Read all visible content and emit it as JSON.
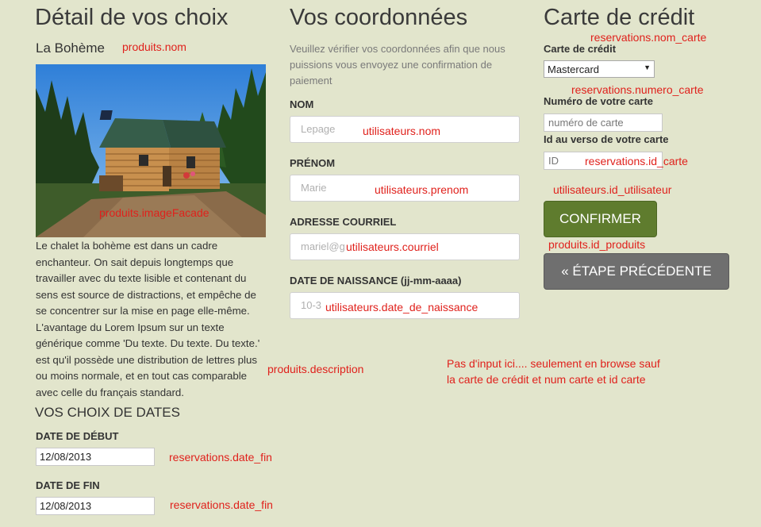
{
  "left": {
    "title": "Détail de vos choix",
    "product_name": "La Bohème",
    "description": "Le chalet la bohème est dans un cadre enchanteur. On sait depuis longtemps que travailler avec du texte lisible et contenant du sens est source de distractions, et empêche de se concentrer sur la mise en page elle-même. L'avantage du Lorem Ipsum sur un texte générique comme 'Du texte. Du texte. Du texte.' est qu'il possède une distribution de lettres plus ou moins normale, et en tout cas comparable avec celle du français standard.",
    "dates_heading": "VOS CHOIX DE DATES",
    "start_label": "DATE DE DÉBUT",
    "start_value": "12/08/2013",
    "end_label": "DATE DE FIN",
    "end_value": "12/08/2013"
  },
  "middle": {
    "title": "Vos coordonnées",
    "intro": "Veuillez vérifier vos coordonnées afin que nous puissions vous envoyez une confirmation de paiement",
    "nom_label": "NOM",
    "nom_value": "Lepage",
    "prenom_label": "PRÉNOM",
    "prenom_value": "Marie",
    "courriel_label": "ADRESSE COURRIEL",
    "courriel_value": "mariel@g",
    "naissance_label": "DATE DE NAISSANCE (jj-mm-aaaa)",
    "naissance_value": "10-3"
  },
  "right": {
    "title": "Carte de crédit",
    "card_type_label": "Carte de crédit",
    "card_type_value": "Mastercard",
    "card_number_label": "Numéro de votre carte",
    "card_number_placeholder": "numéro de carte",
    "card_id_label": "Id au verso de votre carte",
    "card_id_placeholder": "ID",
    "confirm_button": "CONFIRMER",
    "previous_button": "« ÉTAPE PRÉCÉDENTE"
  },
  "annotations": {
    "produits_nom": "produits.nom",
    "produits_image": "produits.imageFacade",
    "produits_description": "produits.description",
    "date_debut": "reservations.date_fin",
    "date_fin": "reservations.date_fin",
    "u_nom": "utilisateurs.nom",
    "u_prenom": "utilisateurs.prenom",
    "u_courriel": "utilisateurs.courriel",
    "u_naissance": "utilisateurs.date_de_naissance",
    "r_nom_carte": "reservations.nom_carte",
    "r_numero_carte": "reservations.numero_carte",
    "r_id_carte": "reservations.id_carte",
    "u_id": "utilisateurs.id_utilisateur",
    "p_id": "produits.id_produits",
    "note_line1": "Pas d'input ici.... seulement en browse sauf",
    "note_line2": "la carte de crédit et num carte et id carte"
  },
  "colors": {
    "background": "#e2e5cc",
    "confirm_button": "#5f7c2e",
    "previous_button": "#6f6f6f",
    "annotation": "#e0211c"
  }
}
